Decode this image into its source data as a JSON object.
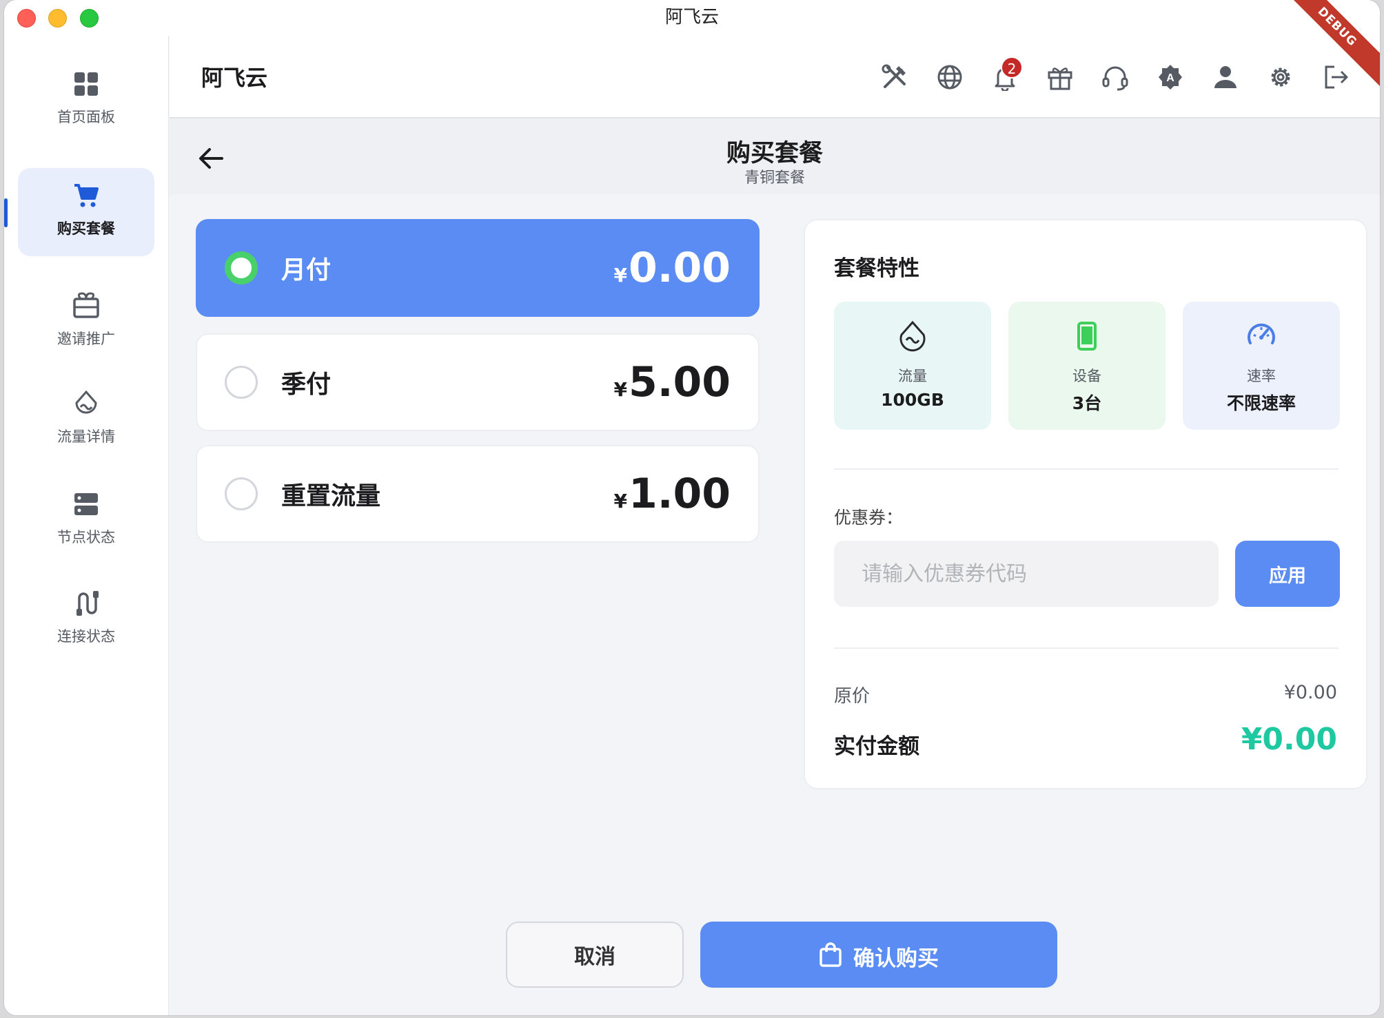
{
  "window": {
    "title": "阿飞云",
    "debug_label": "DEBUG"
  },
  "sidebar": {
    "items": [
      {
        "label": "首页面板",
        "icon": "dashboard-icon",
        "active": false
      },
      {
        "label": "购买套餐",
        "icon": "cart-icon",
        "active": true
      },
      {
        "label": "邀请推广",
        "icon": "invite-icon",
        "active": false
      },
      {
        "label": "流量详情",
        "icon": "traffic-icon",
        "active": false
      },
      {
        "label": "节点状态",
        "icon": "server-icon",
        "active": false
      },
      {
        "label": "连接状态",
        "icon": "connection-icon",
        "active": false
      }
    ]
  },
  "header": {
    "title": "阿飞云",
    "icons": [
      "tools-icon",
      "globe-icon",
      "bell-icon",
      "gift-icon",
      "headset-icon",
      "badge-a-icon",
      "user-icon",
      "gear-icon",
      "logout-icon"
    ],
    "notification_count": "2"
  },
  "page": {
    "title": "购买套餐",
    "subtitle": "青铜套餐"
  },
  "plans": [
    {
      "label": "月付",
      "currency": "¥",
      "price": "0.00",
      "selected": true
    },
    {
      "label": "季付",
      "currency": "¥",
      "price": "5.00",
      "selected": false
    },
    {
      "label": "重置流量",
      "currency": "¥",
      "price": "1.00",
      "selected": false
    }
  ],
  "features": {
    "title": "套餐特性",
    "items": [
      {
        "label": "流量",
        "value": "100GB",
        "icon": "traffic-drop-icon",
        "color": "#2a2a2a",
        "bg": "#e8f7f5"
      },
      {
        "label": "设备",
        "value": "3台",
        "icon": "phone-icon",
        "color": "#3ccf5a",
        "bg": "#eaf8ee"
      },
      {
        "label": "速率",
        "value": "不限速率",
        "icon": "speedometer-icon",
        "color": "#4a7ee6",
        "bg": "#ecf1fc"
      }
    ]
  },
  "coupon": {
    "label": "优惠券：",
    "placeholder": "请输入优惠券代码",
    "value": "",
    "apply_label": "应用"
  },
  "summary": {
    "original_label": "原价",
    "original_value": "¥0.00",
    "total_label": "实付金额",
    "total_value": "¥0.00"
  },
  "actions": {
    "cancel_label": "取消",
    "confirm_label": "确认购买"
  },
  "colors": {
    "accent": "#5b8cf4",
    "success": "#1ec8a0",
    "radio_selected": "#4ad06a",
    "badge": "#c62828"
  }
}
